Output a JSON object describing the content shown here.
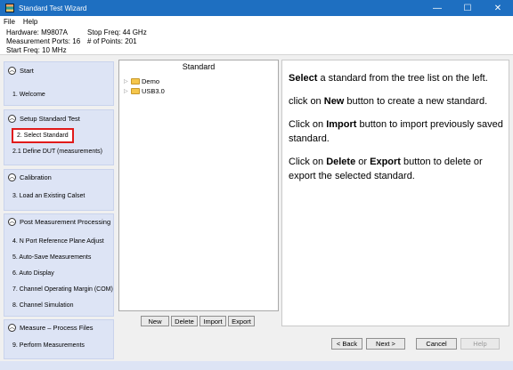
{
  "window": {
    "title": "Standard Test Wizard",
    "minimize": "—",
    "maximize": "☐",
    "close": "✕"
  },
  "menu": {
    "file": "File",
    "help": "Help"
  },
  "info": {
    "hardware": "Hardware: M9807A",
    "ports": "Measurement Ports: 16",
    "start_freq": "Start Freq: 10 MHz",
    "stop_freq": "Stop Freq: 44 GHz",
    "points": "# of Points: 201"
  },
  "sidebar": {
    "groups": [
      {
        "title": "Start",
        "steps": [
          "1. Welcome"
        ]
      },
      {
        "title": "Setup Standard Test",
        "steps": [
          "2. Select Standard",
          "2.1 Define DUT   (measurements)"
        ]
      },
      {
        "title": "Calibration",
        "steps": [
          "3. Load an Existing Calset"
        ]
      },
      {
        "title": "Post Measurement Processing",
        "steps": [
          "4. N Port Reference Plane Adjust",
          "5. Auto-Save Measurements",
          "6. Auto Display",
          "7. Channel Operating Margin (COM)",
          "8. Channel Simulation"
        ]
      },
      {
        "title": "Measure – Process Files",
        "steps": [
          "9. Perform Measurements"
        ]
      }
    ]
  },
  "tree": {
    "header": "Standard",
    "nodes": [
      "Demo",
      "USB3.0"
    ]
  },
  "tree_buttons": {
    "new": "New",
    "delete": "Delete",
    "import": "Import",
    "export": "Export"
  },
  "help": {
    "p1_bold": "Select",
    "p1_rest": " a standard from the tree list on the left.",
    "p2_pre": "click on ",
    "p2_bold": "New",
    "p2_rest": " button to create a new standard.",
    "p3_pre": "Click on ",
    "p3_bold": "Import",
    "p3_rest": " button to import previously saved standard.",
    "p4_pre": "Click on ",
    "p4_bold1": "Delete",
    "p4_mid": " or ",
    "p4_bold2": "Export",
    "p4_rest": " button to delete or export the selected standard."
  },
  "footer": {
    "back": "< Back",
    "next": "Next >",
    "cancel": "Cancel",
    "help": "Help"
  }
}
